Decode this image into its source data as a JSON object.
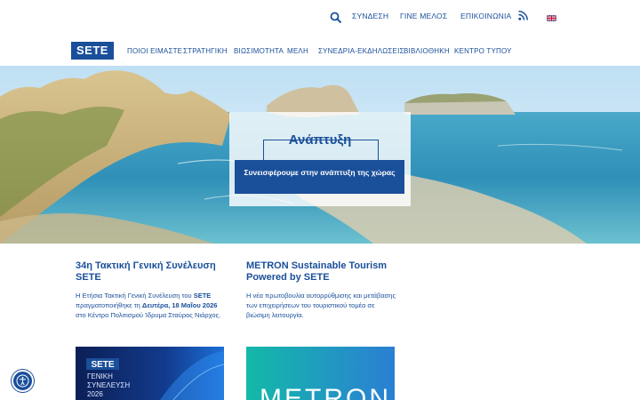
{
  "topbar": {
    "search_icon": "search-icon",
    "login": "ΣΥΝΔΕΣΗ",
    "become_member": "ΓΙΝΕ ΜΕΛΟΣ",
    "contact": "ΕΠΙΚΟΙΝΩΝΙΑ",
    "rss_icon": "rss-icon",
    "language_flag": "uk-flag-icon"
  },
  "nav": {
    "logo": "SETE",
    "items": [
      {
        "label": "ΠΟΙΟΙ ΕΙΜΑΣΤΕ"
      },
      {
        "label": "ΣΤΡΑΤΗΓΙΚΗ"
      },
      {
        "label": "ΒΙΩΣΙΜΟΤΗΤΑ"
      },
      {
        "label": "ΜΕΛΗ"
      },
      {
        "label": "ΣΥΝΕΔΡΙΑ-ΕΚΔΗΛΩΣΕΙΣ"
      },
      {
        "label": "ΒΙΒΛΙΟΘΗΚΗ"
      },
      {
        "label": "ΚΕΝΤΡΟ ΤΥΠΟΥ"
      }
    ]
  },
  "hero": {
    "title": "Ανάπτυξη",
    "tagline": "Συνεισφέρουμε στην ανάπτυξη της χώρας"
  },
  "articles": [
    {
      "title": "34η Τακτική Γενική Συνέλευση SETE",
      "body_1": "Η Ετήσια Τακτική Γενική Συνέλευση του ",
      "body_bold_1": "SETE",
      "body_2": " πραγματοποιήθηκε τη ",
      "body_bold_2": "Δευτέρα, 18 Μαΐου 2026",
      "body_3": " στο Κέντρο Πολιτισμού Ίδρυμα Σταύρος Νιάρχος."
    },
    {
      "title": "METRON Sustainable Tourism Powered by SETE",
      "body": "Η νέα πρωτοβουλία αυτορρύθμισης και μετάβασης των επιχειρήσεων του τουριστικού τομέα σε βιώσιμη λειτουργία."
    }
  ],
  "thumbs": [
    {
      "logo": "SETE",
      "line1": "ΓΕΝΙΚΗ",
      "line2": "ΣΥΝΕΛΕΥΣΗ",
      "year": "2026"
    },
    {
      "wordmark": "METRON"
    }
  ],
  "accessibility_icon": "accessibility-icon",
  "colors": {
    "brand": "#1a4f9a",
    "metron_teal": "#1fb8b0"
  }
}
